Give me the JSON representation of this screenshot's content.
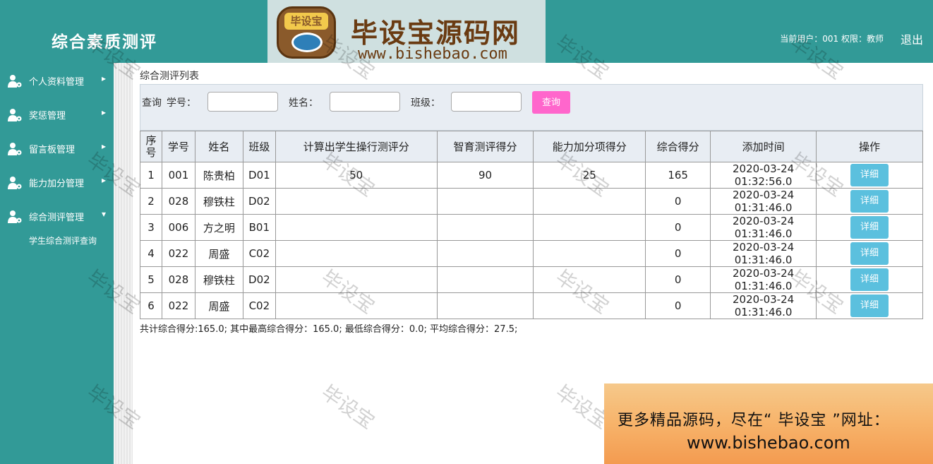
{
  "header": {
    "title": "综合素质测评",
    "user_info": "当前用户：001 权限：教师",
    "logout": "退出"
  },
  "logo": {
    "badge": "毕设宝",
    "main": "毕设宝源码网",
    "url": "www.bishebao.com"
  },
  "sidebar": {
    "items": [
      {
        "label": "个人资料管理",
        "arrow": "▸"
      },
      {
        "label": "奖惩管理",
        "arrow": "▸"
      },
      {
        "label": "留言板管理",
        "arrow": "▸"
      },
      {
        "label": "能力加分管理",
        "arrow": "▸"
      },
      {
        "label": "综合测评管理",
        "arrow": "▾"
      }
    ],
    "sub_item": "学生综合测评查询"
  },
  "breadcrumb": "综合测评列表",
  "search": {
    "query_label": "查询",
    "student_id_label": "学号：",
    "name_label": "姓名：",
    "class_label": "班级：",
    "button": "查询"
  },
  "table": {
    "headers": [
      "序号",
      "学号",
      "姓名",
      "班级",
      "计算出学生操行测评分",
      "智育测评得分",
      "能力加分项得分",
      "综合得分",
      "添加时间",
      "操作"
    ],
    "rows": [
      {
        "idx": "1",
        "sid": "001",
        "name": "陈贵柏",
        "cls": "D01",
        "conduct": "50",
        "intel": "90",
        "ability": "25",
        "total": "165",
        "date": "2020-03-24",
        "time": "01:32:56.0",
        "action": "详细"
      },
      {
        "idx": "2",
        "sid": "028",
        "name": "穆铁柱",
        "cls": "D02",
        "conduct": "",
        "intel": "",
        "ability": "",
        "total": "0",
        "date": "2020-03-24",
        "time": "01:31:46.0",
        "action": "详细"
      },
      {
        "idx": "3",
        "sid": "006",
        "name": "方之明",
        "cls": "B01",
        "conduct": "",
        "intel": "",
        "ability": "",
        "total": "0",
        "date": "2020-03-24",
        "time": "01:31:46.0",
        "action": "详细"
      },
      {
        "idx": "4",
        "sid": "022",
        "name": "周盛",
        "cls": "C02",
        "conduct": "",
        "intel": "",
        "ability": "",
        "total": "0",
        "date": "2020-03-24",
        "time": "01:31:46.0",
        "action": "详细"
      },
      {
        "idx": "5",
        "sid": "028",
        "name": "穆铁柱",
        "cls": "D02",
        "conduct": "",
        "intel": "",
        "ability": "",
        "total": "0",
        "date": "2020-03-24",
        "time": "01:31:46.0",
        "action": "详细"
      },
      {
        "idx": "6",
        "sid": "022",
        "name": "周盛",
        "cls": "C02",
        "conduct": "",
        "intel": "",
        "ability": "",
        "total": "0",
        "date": "2020-03-24",
        "time": "01:31:46.0",
        "action": "详细"
      }
    ]
  },
  "summary": "共计综合得分:165.0;  其中最高综合得分：165.0;  最低综合得分：0.0;  平均综合得分：27.5;",
  "watermark": "毕设宝",
  "ad": {
    "line1": "更多精品源码，尽在“ 毕设宝 ”网址：",
    "line2": "www.bishebao.com"
  }
}
